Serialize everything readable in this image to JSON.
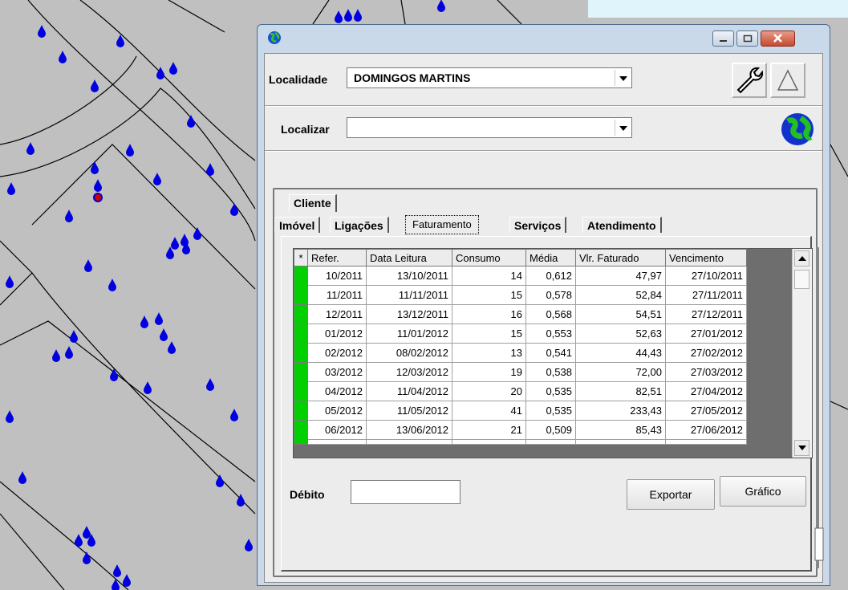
{
  "window": {
    "localidade_label": "Localidade",
    "localidade_value": "DOMINGOS MARTINS",
    "localizar_label": "Localizar",
    "localizar_value": ""
  },
  "tabs": {
    "top": [
      "Cliente"
    ],
    "bottom": [
      "Imóvel",
      "Ligações",
      "Faturamento",
      "Serviços",
      "Atendimento"
    ],
    "active": "Faturamento"
  },
  "table": {
    "columns": [
      "*",
      "Refer.",
      "Data Leitura",
      "Consumo",
      "Média",
      "Vlr. Faturado",
      "Vencimento"
    ],
    "rows": [
      [
        "10/2011",
        "13/10/2011",
        "14",
        "0,612",
        "47,97",
        "27/10/2011"
      ],
      [
        "11/2011",
        "11/11/2011",
        "15",
        "0,578",
        "52,84",
        "27/11/2011"
      ],
      [
        "12/2011",
        "13/12/2011",
        "16",
        "0,568",
        "54,51",
        "27/12/2011"
      ],
      [
        "01/2012",
        "11/01/2012",
        "15",
        "0,553",
        "52,63",
        "27/01/2012"
      ],
      [
        "02/2012",
        "08/02/2012",
        "13",
        "0,541",
        "44,43",
        "27/02/2012"
      ],
      [
        "03/2012",
        "12/03/2012",
        "19",
        "0,538",
        "72,00",
        "27/03/2012"
      ],
      [
        "04/2012",
        "11/04/2012",
        "20",
        "0,535",
        "82,51",
        "27/04/2012"
      ],
      [
        "05/2012",
        "11/05/2012",
        "41",
        "0,535",
        "233,43",
        "27/05/2012"
      ],
      [
        "06/2012",
        "13/06/2012",
        "21",
        "0,509",
        "85,43",
        "27/06/2012"
      ]
    ]
  },
  "debito": {
    "label": "Débito",
    "value": ""
  },
  "buttons": {
    "exportar": "Exportar",
    "grafico": "Gráfico"
  },
  "colors": {
    "marker": "#00d000",
    "drop": "#0000e0",
    "map_bg": "#c0c0c0"
  }
}
